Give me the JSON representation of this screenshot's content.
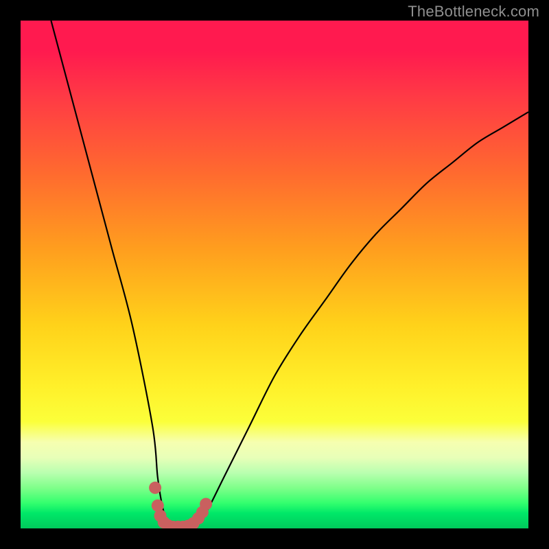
{
  "watermark": {
    "text": "TheBottleneck.com"
  },
  "chart_data": {
    "type": "line",
    "title": "",
    "xlabel": "",
    "ylabel": "",
    "xlim": [
      0,
      100
    ],
    "ylim": [
      0,
      100
    ],
    "series": [
      {
        "name": "bottleneck-curve",
        "x": [
          6,
          10,
          14,
          18,
          22,
          26,
          27,
          28,
          29,
          30,
          31,
          33,
          35,
          37,
          40,
          45,
          50,
          55,
          60,
          65,
          70,
          75,
          80,
          85,
          90,
          95,
          100
        ],
        "values": [
          100,
          85,
          70,
          55,
          40,
          20,
          10,
          4,
          1,
          0,
          0,
          0,
          1,
          4,
          10,
          20,
          30,
          38,
          45,
          52,
          58,
          63,
          68,
          72,
          76,
          79,
          82
        ]
      }
    ],
    "markers": {
      "name": "highlight-dots",
      "color": "#c9605f",
      "points": [
        {
          "x": 26.5,
          "y": 8
        },
        {
          "x": 27.0,
          "y": 4.5
        },
        {
          "x": 27.5,
          "y": 2.5
        },
        {
          "x": 28.2,
          "y": 1.2
        },
        {
          "x": 29.0,
          "y": 0.6
        },
        {
          "x": 30.0,
          "y": 0.3
        },
        {
          "x": 31.0,
          "y": 0.3
        },
        {
          "x": 32.0,
          "y": 0.3
        },
        {
          "x": 33.0,
          "y": 0.5
        },
        {
          "x": 34.0,
          "y": 1.0
        },
        {
          "x": 35.0,
          "y": 2.0
        },
        {
          "x": 35.8,
          "y": 3.2
        },
        {
          "x": 36.5,
          "y": 4.8
        }
      ]
    },
    "gradient_stops": [
      {
        "pos": 0,
        "color": "#ff1a4f"
      },
      {
        "pos": 30,
        "color": "#ff6a2f"
      },
      {
        "pos": 60,
        "color": "#ffd21a"
      },
      {
        "pos": 80,
        "color": "#fbff3a"
      },
      {
        "pos": 92,
        "color": "#7fff8a"
      },
      {
        "pos": 100,
        "color": "#00c95c"
      }
    ]
  }
}
